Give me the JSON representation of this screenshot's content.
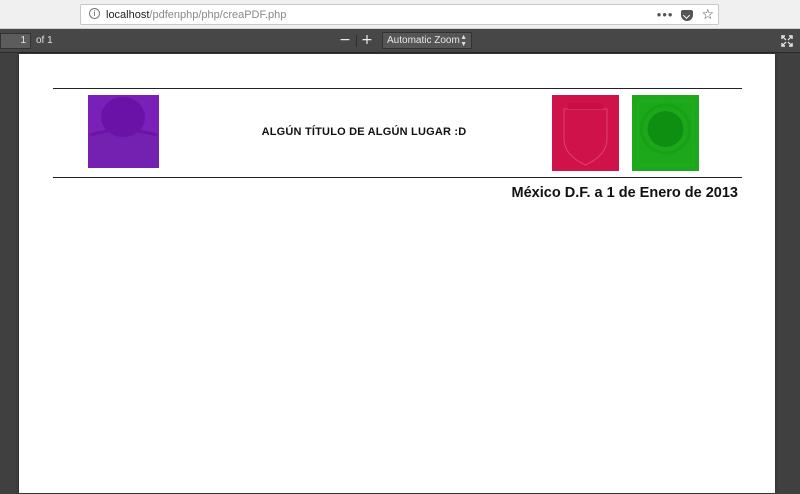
{
  "browser": {
    "url_host": "localhost",
    "url_path": "/pdfenphp/php/creaPDF.php",
    "info_icon": "i",
    "menu_icon": "•••",
    "bookmark_icon": "☆"
  },
  "pdf_toolbar": {
    "page_number": "1",
    "page_count": "of 1",
    "zoom_out": "−",
    "zoom_in": "+",
    "zoom_level": "Automatic Zoom"
  },
  "document": {
    "title": "ALGÚN TÍTULO DE ALGÚN LUGAR :D",
    "date_line": "México D.F. a 1 de Enero de 2013",
    "colors": {
      "logo_left": "#7a1fb8",
      "logo_red": "#d0124a",
      "logo_green": "#1ca81a"
    }
  }
}
